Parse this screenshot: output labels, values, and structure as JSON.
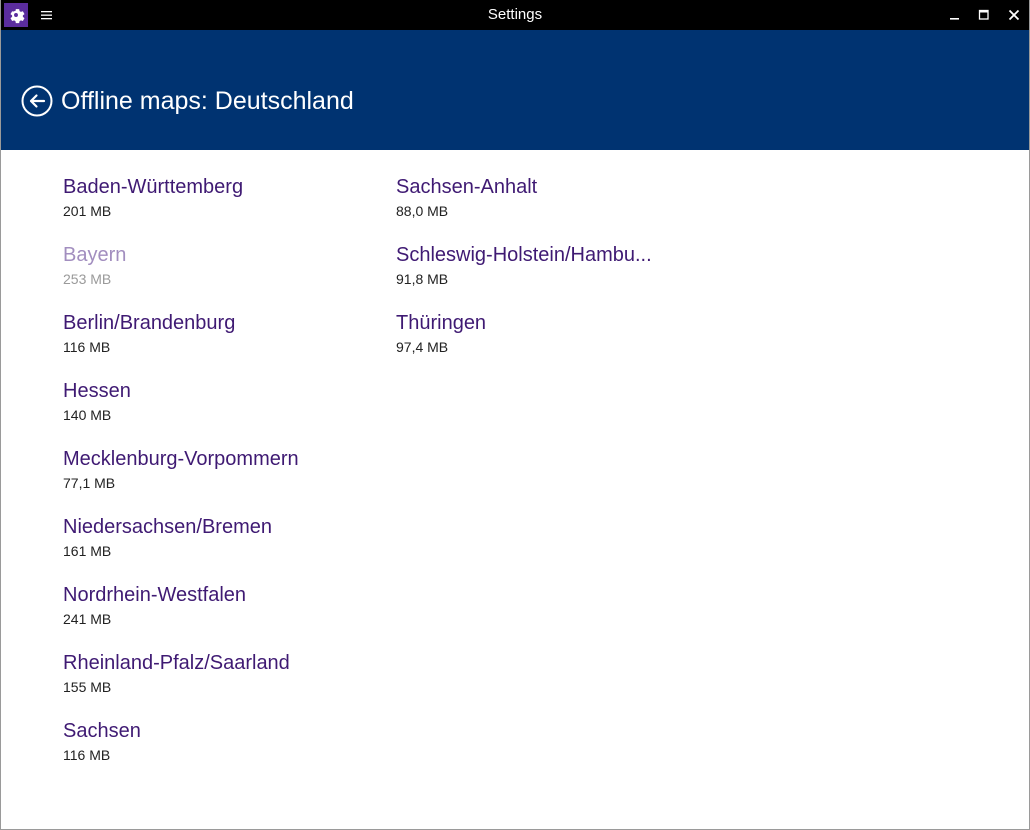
{
  "window": {
    "title": "Settings",
    "icons": {
      "app": "gear-icon",
      "menu": "hamburger-icon",
      "minimize": "minimize-icon",
      "maximize": "maximize-icon",
      "close": "close-icon"
    }
  },
  "header": {
    "back_icon": "back-arrow-icon",
    "title": "Offline maps: Deutschland",
    "background": "#003371"
  },
  "colors": {
    "link": "#3f1a73",
    "link_disabled": "#a28ebf",
    "app_icon": "#5b2d9e"
  },
  "regions_left": [
    {
      "name": "Baden-Württemberg",
      "size": "201 MB",
      "state": "normal"
    },
    {
      "name": "Bayern",
      "size": "253 MB",
      "state": "downloaded"
    },
    {
      "name": "Berlin/Brandenburg",
      "size": "116 MB",
      "state": "normal"
    },
    {
      "name": "Hessen",
      "size": "140 MB",
      "state": "normal"
    },
    {
      "name": "Mecklenburg-Vorpommern",
      "size": "77,1 MB",
      "state": "normal"
    },
    {
      "name": "Niedersachsen/Bremen",
      "size": "161 MB",
      "state": "normal"
    },
    {
      "name": "Nordrhein-Westfalen",
      "size": "241 MB",
      "state": "normal"
    },
    {
      "name": "Rheinland-Pfalz/Saarland",
      "size": "155 MB",
      "state": "normal"
    },
    {
      "name": "Sachsen",
      "size": "116 MB",
      "state": "normal"
    }
  ],
  "regions_right": [
    {
      "name": "Sachsen-Anhalt",
      "size": "88,0 MB",
      "state": "normal"
    },
    {
      "name": "Schleswig-Holstein/Hambu...",
      "size": "91,8 MB",
      "state": "normal"
    },
    {
      "name": "Thüringen",
      "size": "97,4 MB",
      "state": "normal"
    }
  ]
}
